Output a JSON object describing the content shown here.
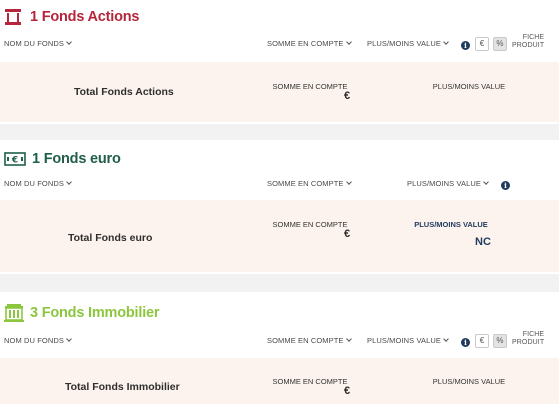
{
  "columns": {
    "name": "NOM DU FONDS",
    "amount": "SOMME EN COMPTE",
    "gain": "PLUS/MOINS VALUE",
    "euro_toggle": "€",
    "percent_toggle": "%",
    "fiche_line1": "FICHE",
    "fiche_line2": "PRODUIT"
  },
  "sections": [
    {
      "title": "1 Fonds Actions",
      "title_color": "#b5263c",
      "icon": "building-columns-icon",
      "total_label": "Total Fonds Actions",
      "amount_label": "SOMME EN COMPTE",
      "amount_value": "€",
      "gain_label": "PLUS/MOINS VALUE",
      "gain_value": ""
    },
    {
      "title": "1 Fonds euro",
      "title_color": "#1f5f4a",
      "icon": "euro-banknote-icon",
      "total_label": "Total Fonds euro",
      "amount_label": "SOMME EN COMPTE",
      "amount_value": "€",
      "gain_label": "PLUS/MOINS VALUE",
      "gain_value": "NC"
    },
    {
      "title": "3 Fonds Immobilier",
      "title_color": "#8cc63f",
      "icon": "office-building-icon",
      "total_label": "Total Fonds Immobilier",
      "amount_label": "SOMME EN COMPTE",
      "amount_value": "€",
      "gain_label": "PLUS/MOINS VALUE",
      "gain_value": ""
    }
  ],
  "colors": {
    "background": "#f2f2f2",
    "panel": "#fdf3ee",
    "info_icon": "#1f3a5c"
  }
}
